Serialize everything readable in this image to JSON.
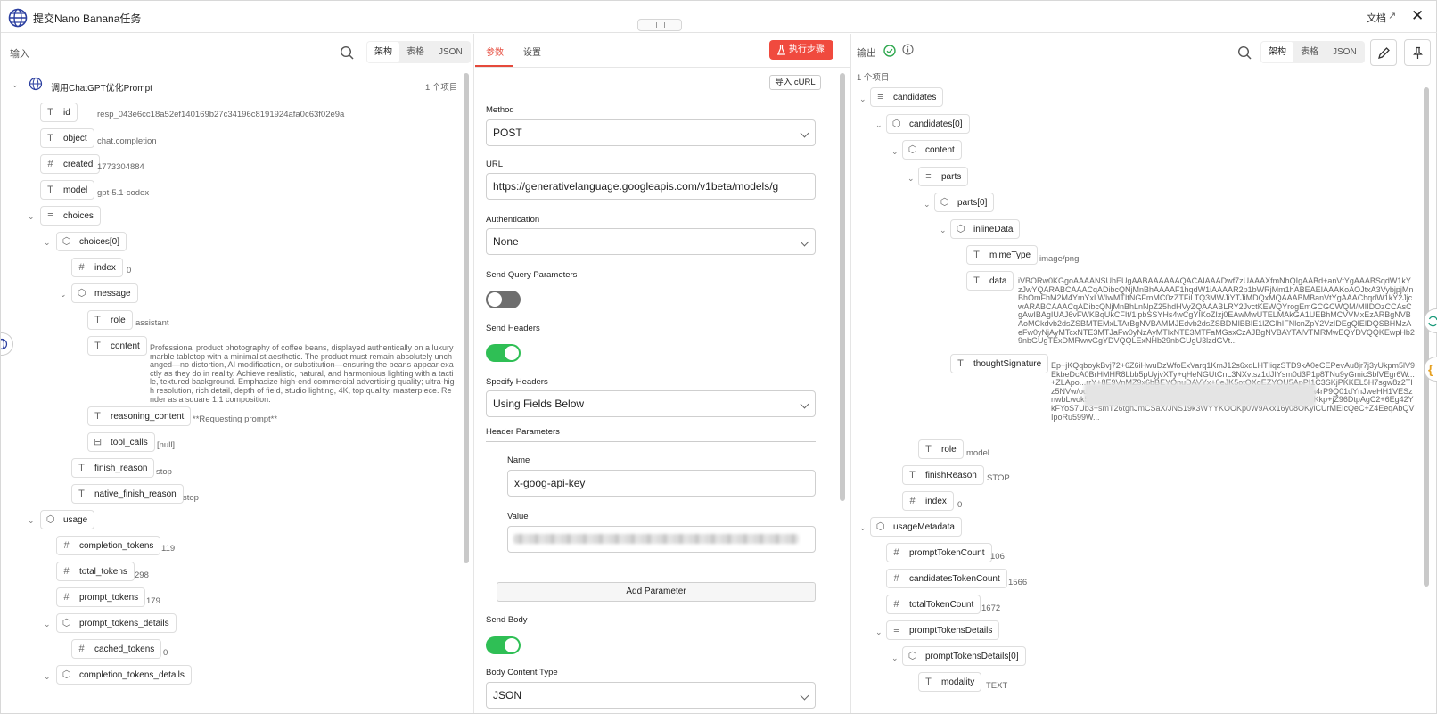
{
  "app": {
    "title": "提交Nano Banana任务",
    "docs_label": "文档",
    "close": "✕"
  },
  "left": {
    "label": "输入",
    "view_tabs": [
      "架构",
      "表格",
      "JSON"
    ],
    "root": {
      "label": "调用ChatGPT优化Prompt",
      "count": "1 个项目"
    },
    "fields": {
      "id": {
        "name": "id",
        "value": "resp_043e6cc18a52ef140169b27c34196c8191924afa0c63f02e9a"
      },
      "object": {
        "name": "object",
        "value": "chat.completion"
      },
      "created": {
        "name": "created",
        "value": "1773304884"
      },
      "model": {
        "name": "model",
        "value": "gpt-5.1-codex"
      },
      "choices": {
        "name": "choices"
      },
      "choices0": {
        "name": "choices[0]"
      },
      "index": {
        "name": "index",
        "value": "0"
      },
      "message": {
        "name": "message"
      },
      "role": {
        "name": "role",
        "value": "assistant"
      },
      "content": {
        "name": "content",
        "value": "Professional product photography of coffee beans, displayed authentically on a luxury marble tabletop with a minimalist aesthetic. The product must remain absolutely unchanged—no distortion, AI modification, or substitution—ensuring the beans appear exactly as they do in reality. Achieve realistic, natural, and harmonious lighting with a tactile, textured background. Emphasize high-end commercial advertising quality; ultra-high resolution, rich detail, depth of field, studio lighting, 4K, top quality, masterpiece. Render as a square 1:1 composition."
      },
      "reasoning": {
        "name": "reasoning_content",
        "value": "**Requesting prompt**"
      },
      "tool_calls": {
        "name": "tool_calls",
        "value": "[null]"
      },
      "finish_reason": {
        "name": "finish_reason",
        "value": "stop"
      },
      "native_finish_reason": {
        "name": "native_finish_reason",
        "value": "stop"
      },
      "usage": {
        "name": "usage"
      },
      "completion_tokens": {
        "name": "completion_tokens",
        "value": "119"
      },
      "total_tokens": {
        "name": "total_tokens",
        "value": "298"
      },
      "prompt_tokens": {
        "name": "prompt_tokens",
        "value": "179"
      },
      "prompt_tokens_details": {
        "name": "prompt_tokens_details"
      },
      "cached_tokens": {
        "name": "cached_tokens",
        "value": "0"
      },
      "completion_tokens_details": {
        "name": "completion_tokens_details"
      }
    }
  },
  "mid": {
    "tabs": [
      "参数",
      "设置"
    ],
    "run_label": "执行步骤",
    "import_curl": "导入 cURL",
    "method": {
      "label": "Method",
      "value": "POST"
    },
    "url": {
      "label": "URL",
      "value": "https://generativelanguage.googleapis.com/v1beta/models/g"
    },
    "auth": {
      "label": "Authentication",
      "value": "None"
    },
    "send_query": {
      "label": "Send Query Parameters",
      "on": false
    },
    "send_headers": {
      "label": "Send Headers",
      "on": true
    },
    "specify_headers": {
      "label": "Specify Headers",
      "value": "Using Fields Below"
    },
    "header_params": {
      "label": "Header Parameters",
      "name_label": "Name",
      "name_value": "x-goog-api-key",
      "value_label": "Value"
    },
    "add_param": "Add Parameter",
    "send_body": {
      "label": "Send Body",
      "on": true
    },
    "body_type": {
      "label": "Body Content Type",
      "value": "JSON"
    },
    "accent": "#f04a3e",
    "toggle_on": "#2fbf55"
  },
  "right": {
    "label": "输出",
    "count": "1 个项目",
    "view_tabs": [
      "架构",
      "表格",
      "JSON"
    ],
    "fields": {
      "candidates": {
        "name": "candidates"
      },
      "candidates0": {
        "name": "candidates[0]"
      },
      "content": {
        "name": "content"
      },
      "parts": {
        "name": "parts"
      },
      "parts0": {
        "name": "parts[0]"
      },
      "inlineData": {
        "name": "inlineData"
      },
      "mimeType": {
        "name": "mimeType",
        "value": "image/png"
      },
      "data": {
        "name": "data",
        "value": "iVBORw0KGgoAAAANSUhEUgAABAAAAAAQACAIAAADwf7zUAAAXfmNhQIgAABd+anVtYgAAABSqdW1kYzJwYQARABCAAACqADibcQNjMnBhAAAAF1hqdW1iAAAAR2p1bWRjMm1hABEAEIAAAKoAOJtxA3VybjpjMnBhOmFhM2M4YmYxLWIwMTItNGFmMC0zZTFiLTQ3MWJiYTJiMDQxMQAAABMBanVtYgAAAChqdW1kY2JjcwARABCAAACqADibcQNjMnBhLnNpZ25hdHVyZQAAABLRY2JvctKEWQYrogEmGCGCWQM/MIIDOzCCAsCgAwIBAgIUAJ6vFWKBqUkCFIt/1ipbSSYHs4wCgYIKoZIzj0EAwMwUTELMAkGA1UEBhMCVVMxEzARBgNVBAoMCkdvb2dsZSBMTEMxLTArBgNVBAMMJEdvb2dsZSBDMlBBIE1lZGlhIFNlcnZpY2VzIDEgQlEIDQSBHMzAeFw0yNjAyMTcxNTE3MTJaFw0yNzAyMTIxNTE3MTFaMGsxCzAJBgNVBAYTAlVTMRMwEQYDVQQKEwpHb29nbGUgTExDMRwwGgYDVQQLExNHb29nbGUgU3lzdGVt..."
      },
      "thought": {
        "name": "thoughtSignature",
        "value": "Ep+jKQqboykBvj72+6Z6iHwuDzWfoExVarq1KmJ12s6xdLHTIiqzSTD9kA0eCEPevAu8jr7j3yUkpm5lV9EkbeDcA0BrHMHR8Lbb5pUyjvXTy+qHeNGUtCnL3NXvtsz1dJIYsm0d3P1p8TNu9yGmicSblVEgr6W...+ZLApo...rrY+8E9VnMZ9x6bBEYQnuDAVYx+0eJK5otQXgEZYQU5ApPI1C3SKjPKKEL5H7sgw8z2TIz5NVw/odvUGonu/cRZy/08IJvSalxihxky8RLhhufpvLCUKPDXM02LxLI4kta4rP9Q01dYnJweHH1VESznwbLwok5SN/68FMnAHx3YIr99SCIEKE00yaxwDbFXc4CXJvtVKTGj7/pUKkp+jZ96DtpAgC2+6Eg42YkFYoS7Ub3+smT26tghJmCSaX/JNS19k3WYYKOOKp0W9Axx16y08OKyiCUrMEIcQeC+Z4EeqAbQVIpoRu599W..."
      },
      "role": {
        "name": "role",
        "value": "model"
      },
      "finishReason": {
        "name": "finishReason",
        "value": "STOP"
      },
      "index": {
        "name": "index",
        "value": "0"
      },
      "usageMetadata": {
        "name": "usageMetadata"
      },
      "promptTokenCount": {
        "name": "promptTokenCount",
        "value": "106"
      },
      "candidatesTokenCount": {
        "name": "candidatesTokenCount",
        "value": "1566"
      },
      "totalTokenCount": {
        "name": "totalTokenCount",
        "value": "1672"
      },
      "promptTokensDetails": {
        "name": "promptTokensDetails"
      },
      "promptTokensDetails0": {
        "name": "promptTokensDetails[0]"
      },
      "modality": {
        "name": "modality",
        "value": "TEXT"
      }
    }
  }
}
